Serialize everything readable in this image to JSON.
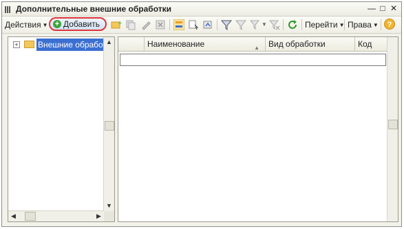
{
  "window": {
    "title": "Дополнительные внешние обработки"
  },
  "toolbar": {
    "actions_label": "Действия",
    "add_label": "Добавить",
    "goto_label": "Перейти",
    "rights_label": "Права",
    "help_label": "?"
  },
  "tree": {
    "items": [
      {
        "label": "Внешние обработки"
      }
    ]
  },
  "grid": {
    "columns": [
      "Наименование",
      "Вид обработки",
      "Код"
    ]
  },
  "colors": {
    "accent": "#3b6fd1",
    "highlight": "#e0333a"
  }
}
